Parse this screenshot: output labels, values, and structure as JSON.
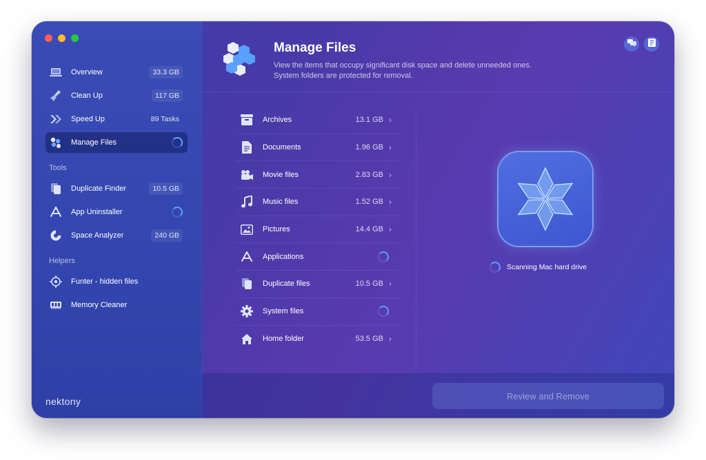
{
  "sidebar": {
    "items": [
      {
        "label": "Overview",
        "badge": "33.3 GB",
        "icon": "laptop-icon"
      },
      {
        "label": "Clean Up",
        "badge": "117 GB",
        "icon": "broom-icon"
      },
      {
        "label": "Speed Up",
        "badge": "89 Tasks",
        "icon": "speed-chevrons-icon"
      },
      {
        "label": "Manage Files",
        "badge": "",
        "icon": "hexagon-files-icon",
        "active": true
      }
    ],
    "tools_label": "Tools",
    "tools": [
      {
        "label": "Duplicate Finder",
        "badge": "10.5 GB",
        "icon": "duplicate-icon"
      },
      {
        "label": "App Uninstaller",
        "badge": "",
        "icon": "app-store-icon"
      },
      {
        "label": "Space Analyzer",
        "badge": "240 GB",
        "icon": "pie-chart-icon"
      }
    ],
    "helpers_label": "Helpers",
    "helpers": [
      {
        "label": "Funter - hidden files",
        "icon": "eye-icon"
      },
      {
        "label": "Memory Cleaner",
        "icon": "memory-chip-icon"
      }
    ],
    "brand": "nektony"
  },
  "header": {
    "title": "Manage Files",
    "description_line1": "View the items that occupy significant disk space and delete unneeded ones.",
    "description_line2": "System folders are protected for removal."
  },
  "files": [
    {
      "label": "Archives",
      "size": "13.1 GB",
      "icon": "archive-box-icon"
    },
    {
      "label": "Documents",
      "size": "1.96 GB",
      "icon": "document-icon"
    },
    {
      "label": "Movie files",
      "size": "2.83 GB",
      "icon": "movie-camera-icon"
    },
    {
      "label": "Music files",
      "size": "1.52 GB",
      "icon": "music-note-icon"
    },
    {
      "label": "Pictures",
      "size": "14.4 GB",
      "icon": "picture-icon"
    },
    {
      "label": "Applications",
      "size": "",
      "icon": "app-store-icon"
    },
    {
      "label": "Duplicate files",
      "size": "10.5 GB",
      "icon": "duplicate-icon"
    },
    {
      "label": "System files",
      "size": "",
      "icon": "gear-icon"
    },
    {
      "label": "Home folder",
      "size": "53.5 GB",
      "icon": "home-icon"
    }
  ],
  "scan": {
    "text": "Scanning Mac hard drive"
  },
  "footer": {
    "review_label": "Review and Remove"
  },
  "colors": {
    "accent": "#5aa0ff",
    "window_bg": "#4a3aa8",
    "sidebar_bg": "#3447b0"
  }
}
